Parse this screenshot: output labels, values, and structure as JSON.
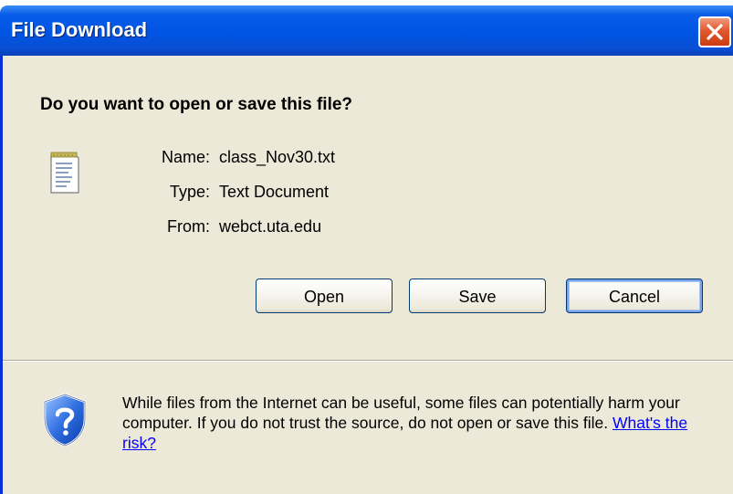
{
  "window": {
    "title": "File Download"
  },
  "dialog": {
    "question": "Do you want to open or save this file?",
    "file_icon": "text-document-icon",
    "fields": [
      {
        "label": "Name:",
        "value": "class_Nov30.txt"
      },
      {
        "label": "Type:",
        "value": "Text Document"
      },
      {
        "label": "From:",
        "value": "webct.uta.edu"
      }
    ],
    "buttons": {
      "open": "Open",
      "save": "Save",
      "cancel": "Cancel"
    },
    "warning": {
      "icon": "shield-question-icon",
      "text": "While files from the Internet can be useful, some files can potentially harm your computer. If you do not trust the source, do not open or save this file.",
      "link": "What's the risk?"
    }
  },
  "colors": {
    "titlebar": "#0054e3",
    "client_bg": "#ece9d8",
    "close_button": "#e3582e",
    "link": "#0000ff"
  }
}
